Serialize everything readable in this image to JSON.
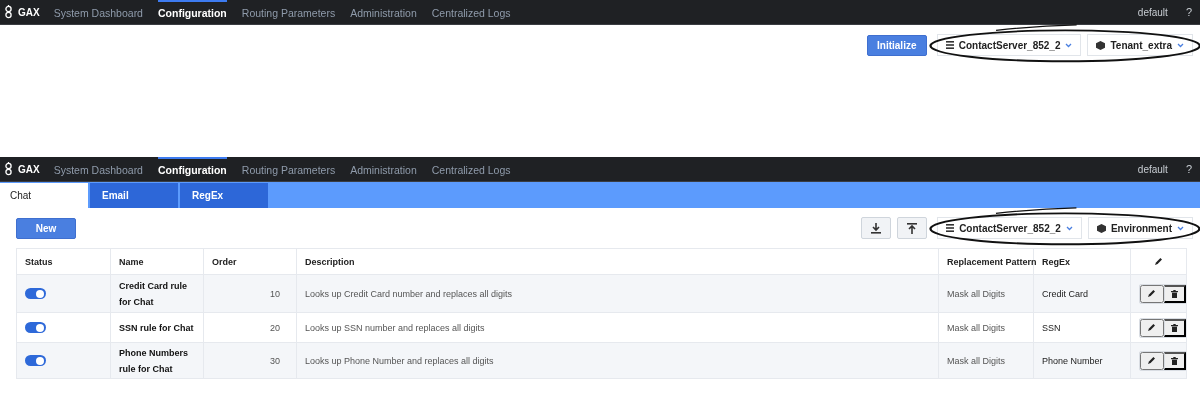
{
  "screens": [
    {
      "brand": "GAX",
      "nav": [
        {
          "label": "System Dashboard",
          "selected": false
        },
        {
          "label": "Configuration",
          "selected": true
        },
        {
          "label": "Routing Parameters",
          "selected": false
        },
        {
          "label": "Administration",
          "selected": false
        },
        {
          "label": "Centralized Logs",
          "selected": false
        }
      ],
      "user": "default",
      "help": "?",
      "toolbar": {
        "buttons": [
          {
            "kind": "text",
            "label": "Initialize"
          }
        ],
        "selectors": [
          {
            "kind": "server",
            "label": "ContactServer_852_2"
          },
          {
            "kind": "tenant",
            "label": "Tenant_extra"
          }
        ],
        "circled": true
      }
    },
    {
      "brand": "GAX",
      "nav": [
        {
          "label": "System Dashboard",
          "selected": false
        },
        {
          "label": "Configuration",
          "selected": true
        },
        {
          "label": "Routing Parameters",
          "selected": false
        },
        {
          "label": "Administration",
          "selected": false
        },
        {
          "label": "Centralized Logs",
          "selected": false
        }
      ],
      "user": "default",
      "help": "?",
      "tabs": [
        {
          "label": "Chat",
          "selected": true
        },
        {
          "label": "Email",
          "selected": false
        },
        {
          "label": "RegEx",
          "selected": false
        }
      ],
      "new_button": "New",
      "toolbar": {
        "buttons": [
          {
            "kind": "download"
          },
          {
            "kind": "upload"
          }
        ],
        "selectors": [
          {
            "kind": "server",
            "label": "ContactServer_852_2"
          },
          {
            "kind": "tenant",
            "label": "Environment"
          }
        ],
        "circled": true
      },
      "table": {
        "columns": [
          "Status",
          "Name",
          "Order",
          "Description",
          "Replacement Pattern",
          "RegEx"
        ],
        "rows": [
          {
            "on": true,
            "name": "Credit Card rule for Chat",
            "order": "10",
            "description": "Looks up Credit Card number and replaces all digits",
            "pattern": "Mask all Digits",
            "regex": "Credit Card"
          },
          {
            "on": true,
            "name": "SSN rule for Chat",
            "order": "20",
            "description": "Looks up SSN number and replaces all digits",
            "pattern": "Mask all Digits",
            "regex": "SSN"
          },
          {
            "on": true,
            "name": "Phone Numbers rule for Chat",
            "order": "30",
            "description": "Looks up Phone Number and replaces all digits",
            "pattern": "Mask all Digits",
            "regex": "Phone Number"
          }
        ]
      }
    }
  ]
}
